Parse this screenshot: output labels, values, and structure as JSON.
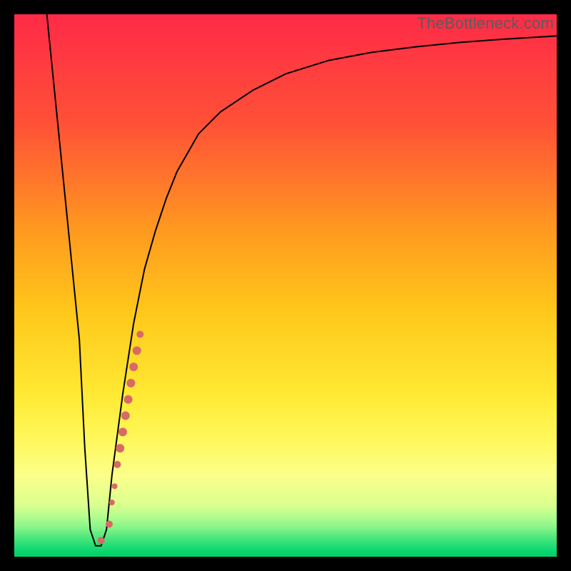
{
  "watermark": "TheBottleneck.com",
  "chart_data": {
    "type": "line",
    "title": "",
    "xlabel": "",
    "ylabel": "",
    "xlim": [
      0,
      100
    ],
    "ylim": [
      0,
      100
    ],
    "curve": {
      "name": "bottleneck-percentage",
      "x": [
        6,
        8,
        10,
        12,
        13,
        14,
        15,
        16,
        17,
        18,
        20,
        22,
        24,
        26,
        28,
        30,
        34,
        38,
        44,
        50,
        58,
        66,
        74,
        82,
        90,
        100
      ],
      "y": [
        100,
        80,
        60,
        40,
        20,
        5,
        2,
        2,
        5,
        15,
        30,
        43,
        53,
        60,
        66,
        71,
        78,
        82,
        86,
        89,
        91.5,
        93,
        94,
        94.8,
        95.4,
        96
      ]
    },
    "dots": {
      "name": "sample-points",
      "color": "#d86a63",
      "points": [
        {
          "x": 16.0,
          "y": 3.0,
          "r": 5
        },
        {
          "x": 17.5,
          "y": 6.0,
          "r": 5
        },
        {
          "x": 18.0,
          "y": 10.0,
          "r": 4
        },
        {
          "x": 18.5,
          "y": 13.0,
          "r": 4
        },
        {
          "x": 19.0,
          "y": 17.0,
          "r": 5
        },
        {
          "x": 19.5,
          "y": 20.0,
          "r": 6
        },
        {
          "x": 20.0,
          "y": 23.0,
          "r": 6
        },
        {
          "x": 20.5,
          "y": 26.0,
          "r": 6
        },
        {
          "x": 21.0,
          "y": 29.0,
          "r": 6
        },
        {
          "x": 21.5,
          "y": 32.0,
          "r": 6
        },
        {
          "x": 22.0,
          "y": 35.0,
          "r": 6
        },
        {
          "x": 22.6,
          "y": 38.0,
          "r": 6
        },
        {
          "x": 23.2,
          "y": 41.0,
          "r": 5
        }
      ]
    },
    "background_gradient": [
      {
        "stop": 0.0,
        "color": "#ff2a47"
      },
      {
        "stop": 0.2,
        "color": "#ff5037"
      },
      {
        "stop": 0.4,
        "color": "#ff9a1f"
      },
      {
        "stop": 0.55,
        "color": "#ffc81a"
      },
      {
        "stop": 0.7,
        "color": "#ffe933"
      },
      {
        "stop": 0.78,
        "color": "#fff75a"
      },
      {
        "stop": 0.85,
        "color": "#fcff8a"
      },
      {
        "stop": 0.905,
        "color": "#d9ff8f"
      },
      {
        "stop": 0.925,
        "color": "#b4fd8f"
      },
      {
        "stop": 0.945,
        "color": "#8af589"
      },
      {
        "stop": 0.962,
        "color": "#55e97e"
      },
      {
        "stop": 0.978,
        "color": "#25de77"
      },
      {
        "stop": 0.992,
        "color": "#06d46d"
      },
      {
        "stop": 1.0,
        "color": "#02cf67"
      }
    ]
  }
}
